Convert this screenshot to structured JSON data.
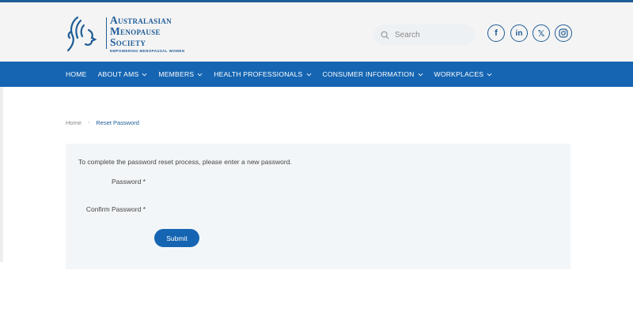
{
  "brand": {
    "name_line1": "Australasian",
    "name_line2": "Menopause",
    "name_line3": "Society",
    "tagline": "EMPOWERING MENOPAUSAL WOMEN",
    "color": "#1e5c97"
  },
  "search": {
    "placeholder": "Search"
  },
  "social": [
    {
      "icon": "facebook-icon",
      "glyph": "f"
    },
    {
      "icon": "linkedin-icon",
      "glyph": "in"
    },
    {
      "icon": "x-icon",
      "glyph": "𝕏"
    },
    {
      "icon": "instagram-icon",
      "glyph": ""
    }
  ],
  "nav": {
    "items": [
      {
        "label": "HOME",
        "has_dropdown": false
      },
      {
        "label": "ABOUT AMS",
        "has_dropdown": true
      },
      {
        "label": "MEMBERS",
        "has_dropdown": true
      },
      {
        "label": "HEALTH PROFESSIONALS",
        "has_dropdown": true
      },
      {
        "label": "CONSUMER INFORMATION",
        "has_dropdown": true
      },
      {
        "label": "WORKPLACES",
        "has_dropdown": true
      }
    ],
    "background": "#1565b2"
  },
  "breadcrumb": {
    "home": "Home",
    "separator": "›",
    "current": "Reset Password"
  },
  "form": {
    "intro": "To complete the password reset process, please enter a new password.",
    "password_label": "Password *",
    "confirm_label": "Confirm Password *",
    "submit_label": "Submit"
  }
}
